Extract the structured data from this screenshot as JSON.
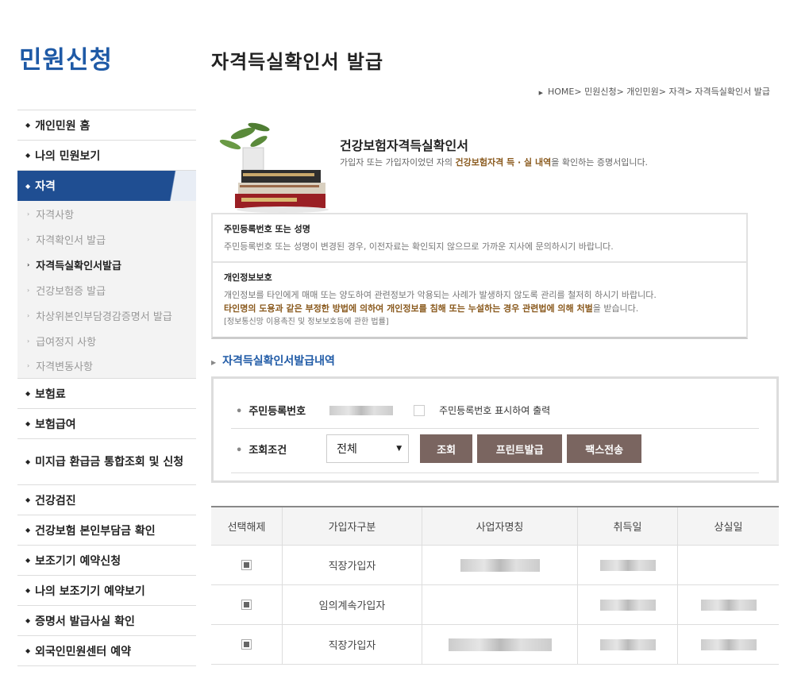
{
  "sidebar": {
    "title": "민원신청",
    "items": [
      {
        "label": "개인민원 홈"
      },
      {
        "label": "나의 민원보기"
      },
      {
        "label": "자격"
      }
    ],
    "sub_items": [
      {
        "label": "자격사항"
      },
      {
        "label": "자격확인서 발급"
      },
      {
        "label": "자격득실확인서발급"
      },
      {
        "label": "건강보험증 발급"
      },
      {
        "label": "차상위본인부담경감증명서 발급"
      },
      {
        "label": "급여정지 사항"
      },
      {
        "label": "자격변동사항"
      }
    ],
    "items_after": [
      {
        "label": "보험료"
      },
      {
        "label": "보험급여"
      },
      {
        "label": "미지급 환급금 통합조회 및 신청"
      },
      {
        "label": "건강검진"
      },
      {
        "label": "건강보험 본인부담금 확인"
      },
      {
        "label": "보조기기 예약신청"
      },
      {
        "label": "나의 보조기기 예약보기"
      },
      {
        "label": "증명서 발급사실 확인"
      },
      {
        "label": "외국인민원센터 예약"
      }
    ]
  },
  "page": {
    "title": "자격득실확인서 발급",
    "breadcrumb": "HOME> 민원신청> 개인민원> 자격> 자격득실확인서 발급"
  },
  "hero": {
    "title": "건강보험자격득실확인서",
    "desc_before": "가입자 또는 가입자이었던 자의 ",
    "desc_em": "건강보험자격 득 · 실 내역",
    "desc_after": "을 확인하는 증명서입니다."
  },
  "notice": {
    "block1_title": "주민등록번호 또는 성명",
    "block1_text": "주민등록번호 또는 성명이 변경된 경우, 이전자료는 확인되지 않으므로 가까운 지사에 문의하시기 바랍니다.",
    "block2_title": "개인정보보호",
    "block2_text": "개인정보를 타인에게 매매 또는 양도하여 관련정보가 악용되는 사례가 발생하지 않도록 관리를 철저히 하시기 바랍니다.",
    "block2_em": "타인명의 도용과 같은 부정한 방법에 의하여 개인정보를 침해 또는 누설하는 경우 관련법에 의해 처벌",
    "block2_em_after": "을 받습니다.",
    "block2_law": "[정보통신망 이용촉진 및 정보보호등에 관한 법률]"
  },
  "section": {
    "title": "자격득실확인서발급내역"
  },
  "form": {
    "rrn_label": "주민등록번호",
    "rrn_checkbox_label": "주민등록번호 표시하여 출력",
    "condition_label": "조회조건",
    "condition_value": "전체",
    "search_button": "조회",
    "print_button": "프린트발급",
    "fax_button": "팩스전송"
  },
  "table": {
    "headers": [
      "선택해제",
      "가입자구분",
      "사업자명칭",
      "취득일",
      "상실일"
    ],
    "rows": [
      {
        "type": "직장가입자"
      },
      {
        "type": "임의계속가입자"
      },
      {
        "type": "직장가입자"
      }
    ]
  }
}
